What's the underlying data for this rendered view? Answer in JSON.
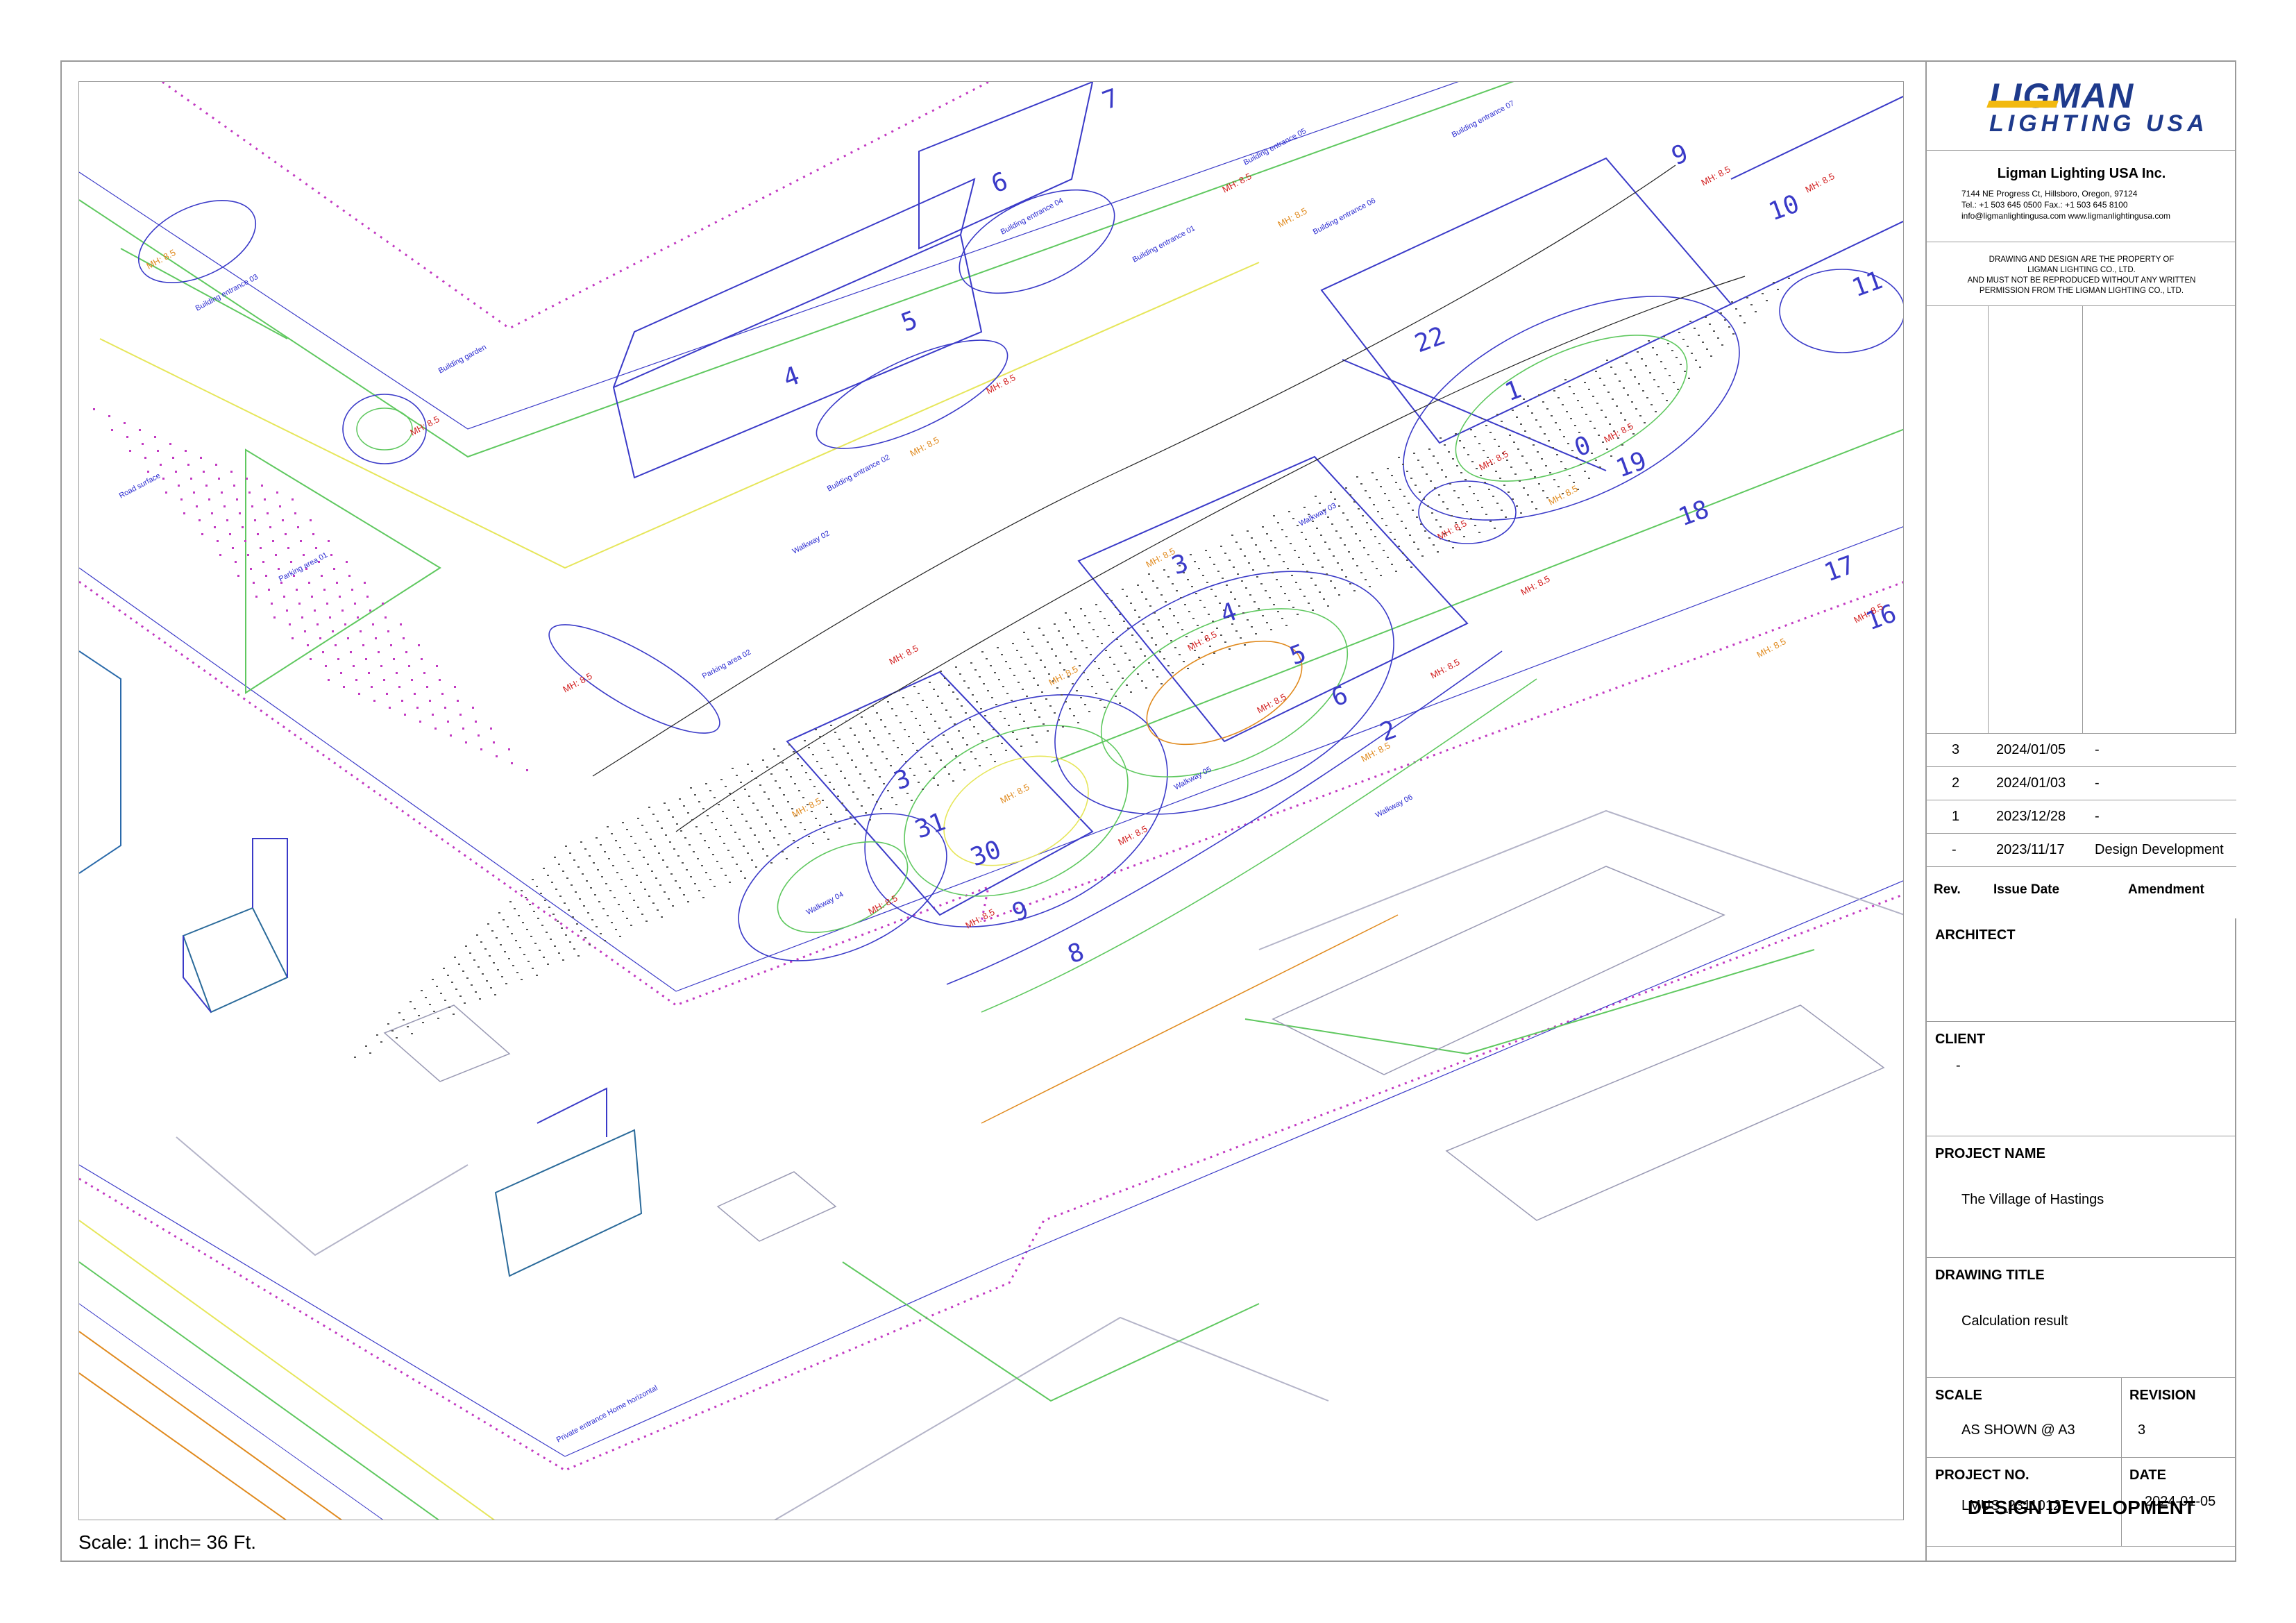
{
  "scale_note": "Scale: 1 inch= 36 Ft.",
  "logo": {
    "main": "LIGMAN",
    "sub": "LIGHTING USA"
  },
  "company": {
    "name": "Ligman Lighting USA Inc.",
    "address_line1": "7144 NE Progress Ct, Hillsboro, Oregon, 97124",
    "address_line2": "Tel.: +1 503 645 0500 Fax.: +1 503 645 8100",
    "address_line3": "info@ligmanlightingusa.com www.ligmanlightingusa.com"
  },
  "notice": {
    "line1": "DRAWING AND DESIGN ARE THE PROPERTY OF",
    "line2": "LIGMAN LIGHTING CO., LTD.",
    "line3": "AND MUST NOT BE REPRODUCED WITHOUT ANY WRITTEN",
    "line4": "PERMISSION FROM THE LIGMAN LIGHTING CO., LTD."
  },
  "revisions": [
    {
      "rev": "3",
      "date": "2024/01/05",
      "amendment": "-"
    },
    {
      "rev": "2",
      "date": "2024/01/03",
      "amendment": "-"
    },
    {
      "rev": "1",
      "date": "2023/12/28",
      "amendment": "-"
    },
    {
      "rev": "-",
      "date": "2023/11/17",
      "amendment": "Design Development"
    }
  ],
  "revision_headers": {
    "rev": "Rev.",
    "date": "Issue Date",
    "amendment": "Amendment"
  },
  "architect": {
    "label": "ARCHITECT",
    "value": ""
  },
  "client": {
    "label": "CLIENT",
    "value": "-"
  },
  "project_name": {
    "label": "PROJECT NAME",
    "value": "The Village of Hastings"
  },
  "drawing_title": {
    "label": "DRAWING TITLE",
    "value": "Calculation result"
  },
  "scale": {
    "label": "SCALE",
    "value": "AS SHOWN @ A3"
  },
  "revision": {
    "label": "REVISION",
    "value": "3"
  },
  "project_no": {
    "label": "PROJECT NO.",
    "value": "LMUS_23110127"
  },
  "date": {
    "label": "DATE",
    "value": "2024-01-05"
  },
  "stamp": "DESIGN DEVELOPMENT",
  "drawing": {
    "building_numbers": [
      "4",
      "5",
      "6",
      "7",
      "9",
      "10",
      "11",
      "22",
      "1",
      "0",
      "19",
      "18",
      "17",
      "16",
      "3",
      "4",
      "5",
      "6",
      "2",
      "3",
      "31",
      "30",
      "9",
      "8"
    ],
    "labels": [
      "Building entrance 01",
      "Building entrance 02",
      "Building entrance 03",
      "Building entrance 04",
      "Building entrance 05",
      "Building entrance 06",
      "Building entrance 07",
      "Walkway 02",
      "Walkway 03",
      "Walkway 04",
      "Walkway 05",
      "Walkway 06",
      "Parking area 01",
      "Parking area 02",
      "Road surface",
      "Building garden",
      "Private entrance Home horizontal"
    ],
    "marker": "MH: 8.5",
    "colors": {
      "blue": "#3a3ac8",
      "green": "#5fc85f",
      "magenta": "#c23ac2",
      "yellow": "#e6e65a",
      "orange": "#e08a1e",
      "red": "#d22020",
      "gray": "#b4b4c8"
    }
  }
}
